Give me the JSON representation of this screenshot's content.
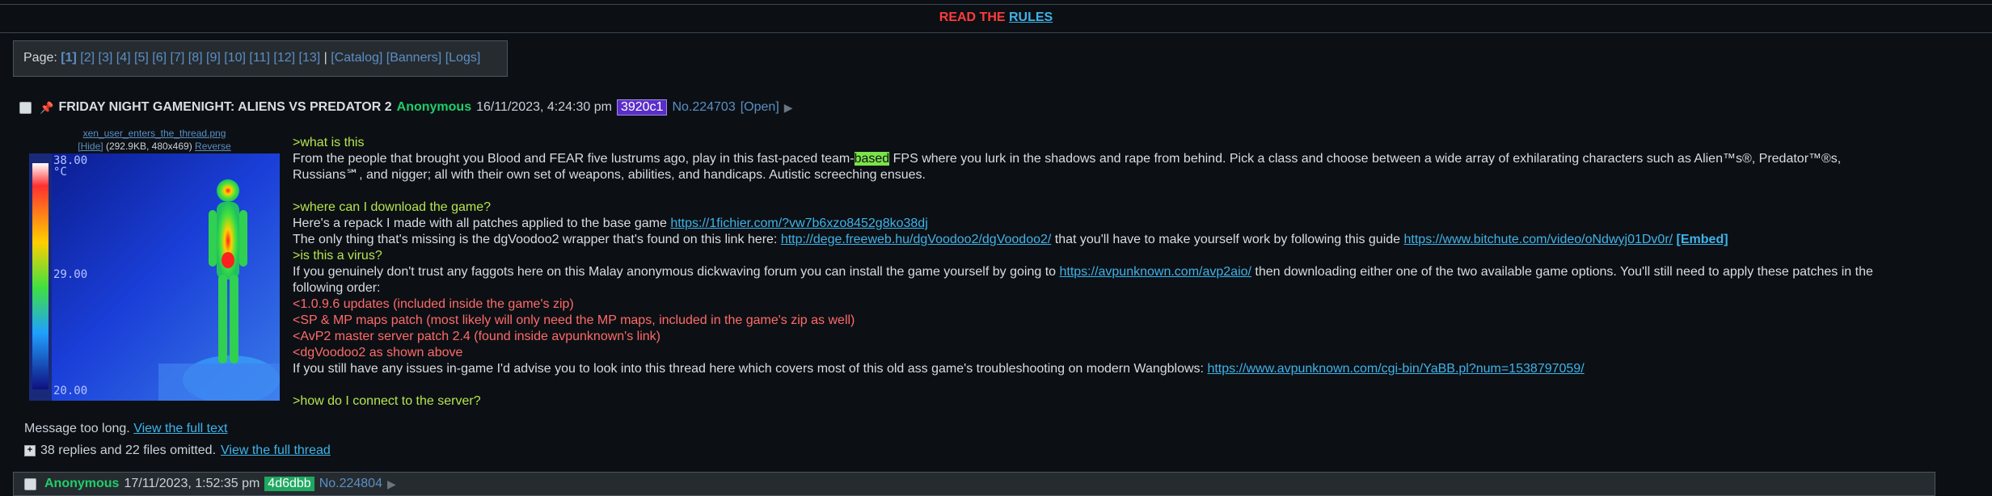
{
  "rules": {
    "prefix": "READ THE",
    "link": "RULES"
  },
  "pagination": {
    "label": "Page:",
    "current": "[1]",
    "pages": [
      "[2]",
      "[3]",
      "[4]",
      "[5]",
      "[6]",
      "[7]",
      "[8]",
      "[9]",
      "[10]",
      "[11]",
      "[12]",
      "[13]"
    ],
    "separator": "|",
    "extras": [
      "[Catalog]",
      "[Banners]",
      "[Logs]"
    ]
  },
  "op": {
    "subject": "FRIDAY NIGHT GAMENIGHT: ALIENS VS PREDATOR 2",
    "name": "Anonymous",
    "date": "16/11/2023, 4:24:30 pm",
    "uid": "3920c1",
    "post_no": "No.224703",
    "open": "[Open]",
    "file": {
      "filename": "xen_user_enters_the_thread.png",
      "hide": "[Hide]",
      "meta": "(292.9KB, 480x469)",
      "reverse": "Reverse",
      "scale_top": "38.00",
      "scale_unit": "°C",
      "scale_mid": "29.00",
      "scale_bottom": "20.00"
    },
    "lines": {
      "q1": ">what is this",
      "l1a": "From the people that brought you Blood and FEAR five lustrums ago, play in this fast-paced team-",
      "l1hl": "based",
      "l1b": " FPS where you lurk in the shadows and rape from behind. Pick a class and choose between a wide array of exhilarating characters such as Alien™s®, Predator™®s,",
      "l2": "Russians℠, and nigger; all with their own set of weapons, abilities, and handicaps. Autistic screeching ensues.",
      "q2": ">where can I download the game?",
      "l3": "Here's a repack I made with all patches applied to the base game ",
      "link1": "https://1fichier.com/?vw7b6xzo8452g8ko38dj",
      "l4a": "The only thing that's missing is the dgVoodoo2 wrapper that's found on this link here: ",
      "link2": "http://dege.freeweb.hu/dgVoodoo2/dgVoodoo2/",
      "l4b": " that you'll have to make yourself work by following this guide ",
      "link3": "https://www.bitchute.com/video/oNdwyj01Dv0r/",
      "embed": "[Embed]",
      "q3": ">is this a virus?",
      "l5a": "If you genuinely don't trust any faggots here on this Malay anonymous dickwaving forum you can install the game yourself by going to ",
      "link4": "https://avpunknown.com/avp2aio/",
      "l5b": " then downloading either one of the two available game options. You'll still need to apply these patches in the",
      "l6": "following order:",
      "r1": "<1.0.9.6 updates (included inside the game's zip)",
      "r2": "<SP & MP maps patch (most likely will only need the MP maps, included in the game's zip as well)",
      "r3": "<AvP2 master server patch 2.4 (found inside avpunknown's link)",
      "r4": "<dgVoodoo2 as shown above",
      "l7": "If you still have any issues in-game I'd advise you to look into this thread here which covers most of this old ass game's troubleshooting on modern Wangblows: ",
      "link5": "https://www.avpunknown.com/cgi-bin/YaBB.pl?num=1538797059/",
      "q4": ">how do I connect to the server?"
    },
    "too_long": "Message too long.",
    "full_text": "View the full text",
    "omitted": "38 replies and 22 files omitted.",
    "full_thread": "View the full thread"
  },
  "reply": {
    "name": "Anonymous",
    "date": "17/11/2023, 1:52:35 pm",
    "uid": "4d6dbb",
    "post_no": "No.224804"
  }
}
